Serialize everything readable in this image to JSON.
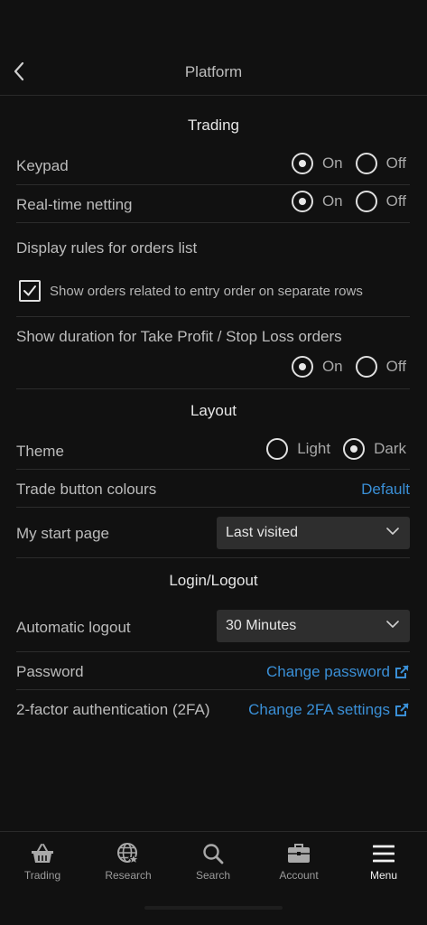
{
  "header": {
    "title": "Platform"
  },
  "trading": {
    "section_title": "Trading",
    "keypad": {
      "label": "Keypad",
      "on": "On",
      "off": "Off",
      "selected": "on"
    },
    "netting": {
      "label": "Real-time netting",
      "on": "On",
      "off": "Off",
      "selected": "on"
    },
    "display_rules": {
      "label": "Display rules for orders list"
    },
    "separate_rows": {
      "label": "Show orders related to entry order on separate rows",
      "checked": true
    },
    "duration": {
      "label": "Show duration for Take Profit / Stop Loss orders",
      "on": "On",
      "off": "Off",
      "selected": "on"
    }
  },
  "layout": {
    "section_title": "Layout",
    "theme": {
      "label": "Theme",
      "light": "Light",
      "dark": "Dark",
      "selected": "dark"
    },
    "trade_colours": {
      "label": "Trade button colours",
      "value": "Default"
    },
    "start_page": {
      "label": "My start page",
      "value": "Last visited"
    }
  },
  "login": {
    "section_title": "Login/Logout",
    "auto_logout": {
      "label": "Automatic logout",
      "value": "30 Minutes"
    },
    "password": {
      "label": "Password",
      "link": "Change password"
    },
    "twofa": {
      "label": "2-factor authentication (2FA)",
      "link": "Change 2FA settings"
    }
  },
  "tabs": [
    {
      "label": "Trading",
      "icon": "basket-icon"
    },
    {
      "label": "Research",
      "icon": "globe-star-icon"
    },
    {
      "label": "Search",
      "icon": "search-icon"
    },
    {
      "label": "Account",
      "icon": "briefcase-icon"
    },
    {
      "label": "Menu",
      "icon": "hamburger-menu-icon",
      "active": true
    }
  ],
  "colors": {
    "background": "#111111",
    "link": "#3a8fd6",
    "select_bg": "#2e2e2e"
  }
}
